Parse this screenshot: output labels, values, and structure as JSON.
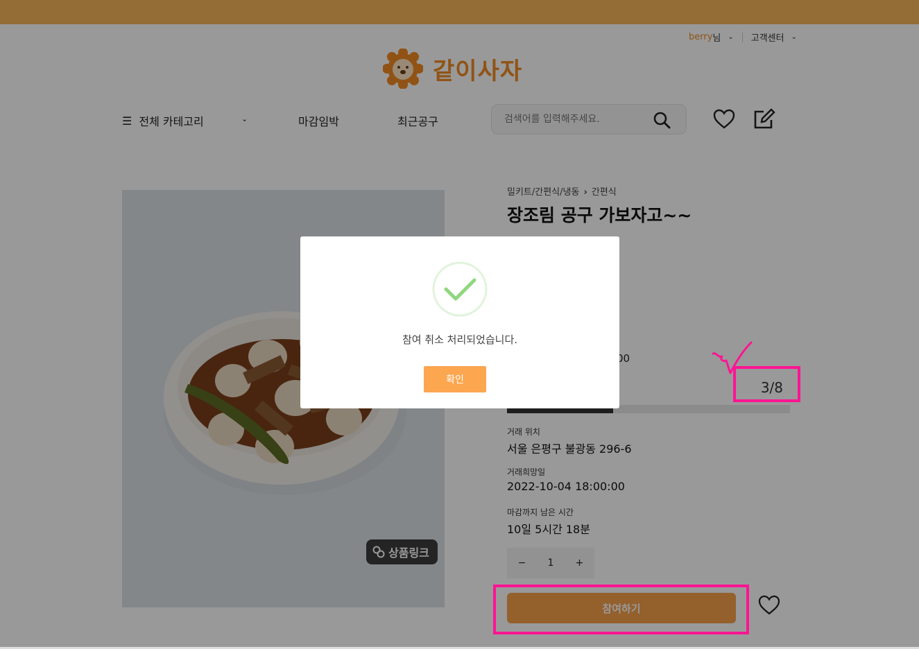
{
  "colors": {
    "brand_orange": "#f08a24",
    "banner": "#f7b55b",
    "annotation_pink": "#ff1493",
    "join_button": "#f7a04a",
    "modal_button": "#fca650",
    "check_green": "#8fd77e"
  },
  "user_menu": {
    "username": "berry",
    "suffix": " 님",
    "customer_center": "고객센터"
  },
  "logo": {
    "text": "같이사자",
    "icon": "lion-icon"
  },
  "nav": {
    "all_categories": "전체 카테고리",
    "deadline": "마감임박",
    "recent": "최근공구",
    "search_placeholder": "검색어를 입력해주세요."
  },
  "product": {
    "breadcrumb_parent": "밀키트/간편식/냉동",
    "breadcrumb_child": "간편식",
    "title": "장조림 공구 가보자고~~",
    "price_partial": "00",
    "participants": "3/8",
    "progress_fraction": 0.375,
    "link_badge": "상품링크",
    "location_label": "거래 위치",
    "location_value": "서울 은평구 불광동 296-6",
    "date_label": "거래희망일",
    "date_value": "2022-10-04 18:00:00",
    "remain_label": "마감까지 남은 시간",
    "remain_value": "10일 5시간 18분",
    "qty_minus": "−",
    "qty_value": "1",
    "qty_plus": "+",
    "join_button": "참여하기"
  },
  "modal": {
    "message": "참여 취소 처리되었습니다.",
    "confirm": "확인",
    "icon": "check-circle-icon"
  }
}
